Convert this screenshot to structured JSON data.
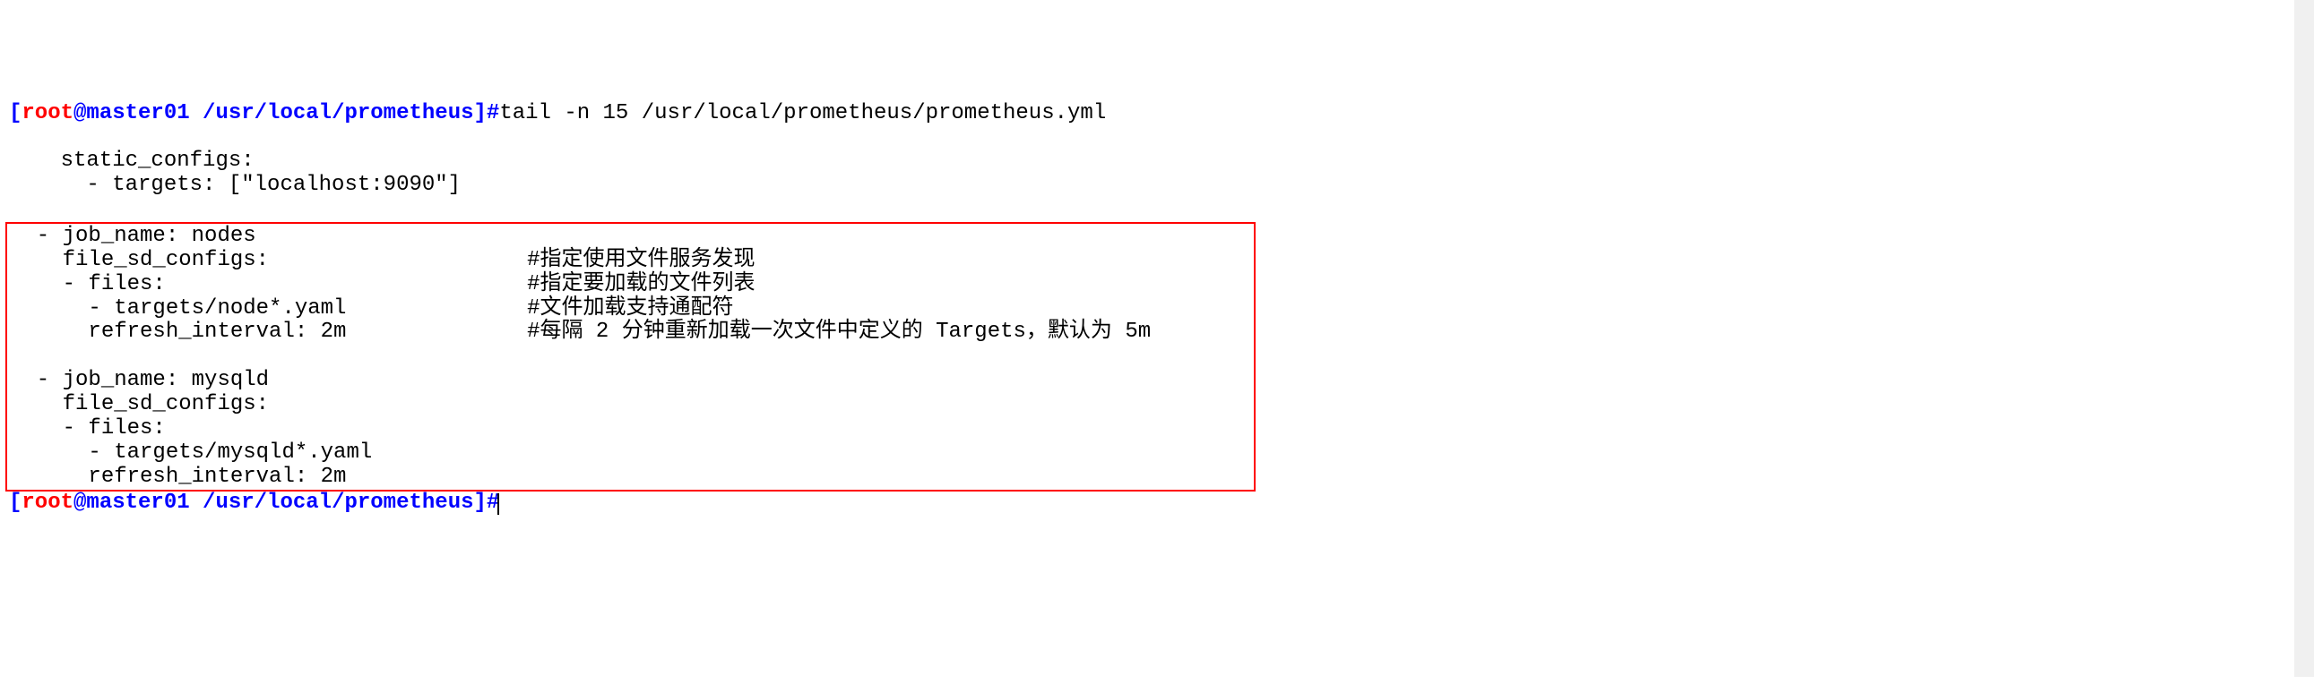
{
  "prompt1": {
    "bracket_open": "[",
    "user": "root",
    "at": "@",
    "host": "master01",
    "space": " ",
    "path": "/usr/local/prometheus",
    "bracket_close": "]",
    "hash": "#",
    "command": "tail -n 15 /usr/local/prometheus/prometheus.yml"
  },
  "output": {
    "line_blank1": "",
    "line_static": "    static_configs:",
    "line_targets_local": "      - targets: [\"localhost:9090\"]",
    "line_blank2": "",
    "box": {
      "line1": "  - job_name: nodes",
      "line2_left": "    file_sd_configs:                    ",
      "line2_comment": "#指定使用文件服务发现",
      "line3_left": "    - files:                            ",
      "line3_comment": "#指定要加载的文件列表",
      "line4_left": "      - targets/node*.yaml              ",
      "line4_comment": "#文件加载支持通配符",
      "line5_left": "      refresh_interval: 2m              ",
      "line5_comment": "#每隔 2 分钟重新加载一次文件中定义的 Targets，默认为 5m",
      "line_blank3": "",
      "line6": "  - job_name: mysqld",
      "line7": "    file_sd_configs:",
      "line8": "    - files:",
      "line9": "      - targets/mysqld*.yaml",
      "line10": "      refresh_interval: 2m"
    }
  },
  "prompt2": {
    "bracket_open": "[",
    "user": "root",
    "at": "@",
    "host": "master01",
    "space": " ",
    "path": "/usr/local/prometheus",
    "bracket_close": "]",
    "hash": "#"
  }
}
